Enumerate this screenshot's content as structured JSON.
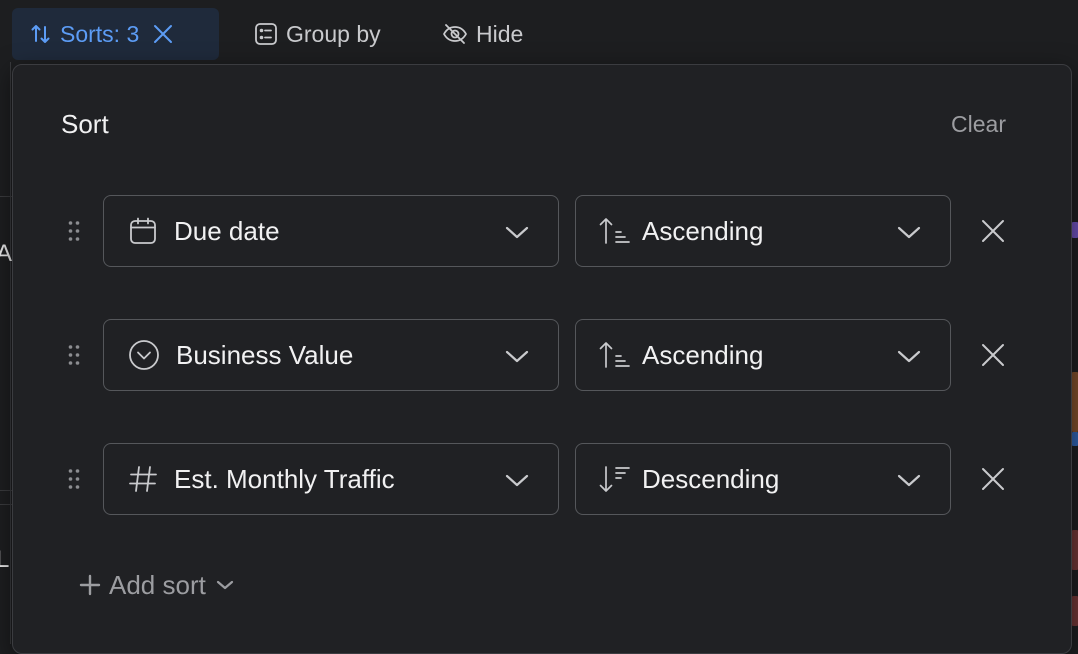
{
  "toolbar": {
    "sorts_label": "Sorts: 3",
    "group_by_label": "Group by",
    "hide_label": "Hide"
  },
  "background": {
    "glyph_a": "A",
    "glyph_l": "L"
  },
  "sort_panel": {
    "title": "Sort",
    "clear_label": "Clear",
    "rules": [
      {
        "field": "Due date",
        "field_icon": "calendar-icon",
        "direction": "Ascending",
        "direction_icon": "sort-ascending-icon"
      },
      {
        "field": "Business Value",
        "field_icon": "select-circle-icon",
        "direction": "Ascending",
        "direction_icon": "sort-ascending-icon"
      },
      {
        "field": "Est. Monthly Traffic",
        "field_icon": "number-hash-icon",
        "direction": "Descending",
        "direction_icon": "sort-descending-icon"
      }
    ],
    "add_sort_label": "Add sort"
  },
  "colors": {
    "accent": "#5c9cf5",
    "panel_bg": "#202124",
    "border": "#55575b",
    "muted_text": "#9c9da1"
  }
}
